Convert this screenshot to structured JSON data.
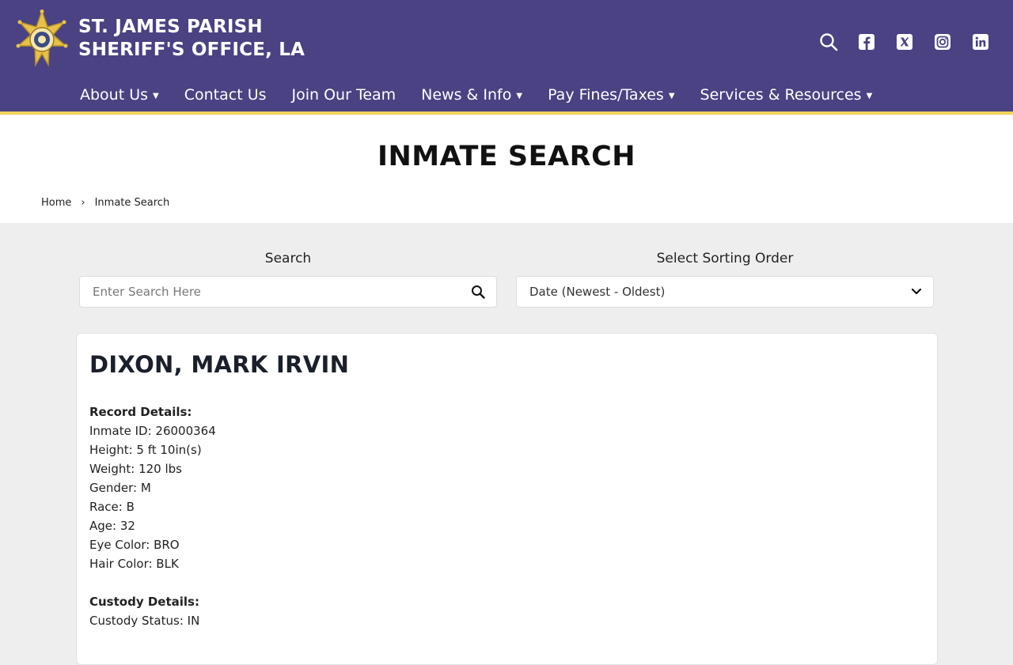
{
  "header": {
    "title_line1": "ST. JAMES PARISH",
    "title_line2": "SHERIFF'S OFFICE, LA",
    "social_icons": [
      "search-icon",
      "facebook-icon",
      "x-icon",
      "instagram-icon",
      "linkedin-icon"
    ]
  },
  "nav": {
    "items": [
      {
        "label": "About Us",
        "dropdown": true
      },
      {
        "label": "Contact Us",
        "dropdown": false
      },
      {
        "label": "Join Our Team",
        "dropdown": false
      },
      {
        "label": "News & Info",
        "dropdown": true
      },
      {
        "label": "Pay Fines/Taxes",
        "dropdown": true
      },
      {
        "label": "Services & Resources",
        "dropdown": true
      }
    ]
  },
  "page": {
    "title": "INMATE SEARCH"
  },
  "breadcrumb": {
    "home": "Home",
    "separator": "›",
    "current": "Inmate Search"
  },
  "filters": {
    "search_label": "Search",
    "search_placeholder": "Enter Search Here",
    "sort_label": "Select Sorting Order",
    "sort_value": "Date (Newest - Oldest)"
  },
  "inmate": {
    "name": "DIXON, MARK IRVIN",
    "record_heading": "Record Details:",
    "record": [
      "Inmate ID: 26000364",
      "Height: 5 ft 10in(s)",
      "Weight: 120 lbs",
      "Gender: M",
      "Race: B",
      "Age: 32",
      "Eye Color: BRO",
      "Hair Color: BLK"
    ],
    "custody_heading": "Custody Details:",
    "custody": [
      "Custody Status: IN"
    ]
  },
  "colors": {
    "header_bg": "#4a4283",
    "accent": "#f2d35a",
    "page_bg": "#eeeeee"
  }
}
